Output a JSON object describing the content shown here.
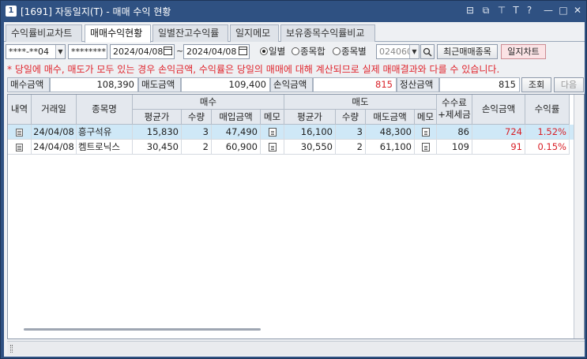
{
  "window": {
    "icon_num": "1",
    "title": "[1691] 자동일지(T) - 매매 수익 현황",
    "controls": [
      "restore-icon",
      "copy-icon",
      "pin-icon",
      "font-icon",
      "help-icon",
      "minimize-icon",
      "maximize-icon",
      "close-icon"
    ],
    "glyphs": {
      "restore": "⊟",
      "copy": "⧉",
      "pin": "⊤",
      "font": "T",
      "help": "?",
      "min": "—",
      "max": "□",
      "close": "✕"
    }
  },
  "tabs": [
    {
      "label": "수익률비교차트",
      "active": false
    },
    {
      "label": "매매수익현황",
      "active": true
    },
    {
      "label": "일별잔고수익률",
      "active": false
    },
    {
      "label": "일지메모",
      "active": false
    },
    {
      "label": "보유종목수익률비교",
      "active": false
    }
  ],
  "toolbar": {
    "account": "****-**04",
    "password": "********",
    "date_from": "2024/04/08",
    "tilde": "~",
    "date_to": "2024/04/08",
    "radios": [
      {
        "label": "일별",
        "selected": true
      },
      {
        "label": "종목합",
        "selected": false
      },
      {
        "label": "종목별",
        "selected": false
      }
    ],
    "stock_code_placeholder": "024060",
    "recent_button": "최근매매종목",
    "chart_button": "일지차트"
  },
  "notice": "* 당일에 매수, 매도가 모두 있는 경우 손익금액, 수익률은 당일의 매매에 대해 계산되므로 실제 매매결과와 다를 수 있습니다.",
  "summary": {
    "buy_amount_label": "매수금액",
    "buy_amount": "108,390",
    "sell_amount_label": "매도금액",
    "sell_amount": "109,400",
    "pnl_label": "손익금액",
    "pnl": "815",
    "settle_label": "정산금액",
    "settle": "815",
    "query_button": "조회",
    "next_button": "다음"
  },
  "table": {
    "headers": {
      "detail": "내역",
      "date": "거래일",
      "name": "종목명",
      "buy_group": "매수",
      "sell_group": "매도",
      "fee": [
        "수수료",
        "+제세금"
      ],
      "pnl": "손익금액",
      "rate": "수익률",
      "buy_avg": "평균가",
      "buy_qty": "수량",
      "buy_amt": "매입금액",
      "buy_memo": "메모",
      "sell_avg": "평균가",
      "sell_qty": "수량",
      "sell_amt": "매도금액",
      "sell_memo": "메모"
    },
    "rows": [
      {
        "date": "24/04/08",
        "name": "흥구석유",
        "buy_avg": "15,830",
        "buy_qty": "3",
        "buy_amt": "47,490",
        "sell_avg": "16,100",
        "sell_qty": "3",
        "sell_amt": "48,300",
        "fee": "86",
        "pnl": "724",
        "rate": "1.52%",
        "selected": true
      },
      {
        "date": "24/04/08",
        "name": "켐트로닉스",
        "buy_avg": "30,450",
        "buy_qty": "2",
        "buy_amt": "60,900",
        "sell_avg": "30,550",
        "sell_qty": "2",
        "sell_amt": "61,100",
        "fee": "109",
        "pnl": "91",
        "rate": "0.15%",
        "selected": false
      }
    ]
  },
  "colors": {
    "titlebar": "#2f5182",
    "selected_row": "#cfe8f7",
    "profit": "#d81f26",
    "notice": "#e0242c"
  }
}
